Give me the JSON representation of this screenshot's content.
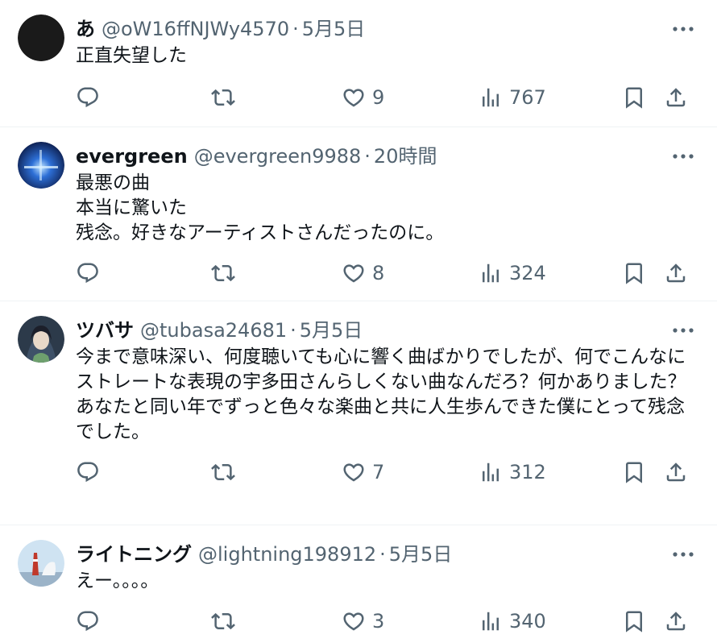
{
  "colors": {
    "text_primary": "#0f1419",
    "text_secondary": "#536471",
    "divider": "#eff3f4"
  },
  "tweets": [
    {
      "display_name": "あ",
      "handle": "@oW16ffNJWy4570",
      "separator": "·",
      "time": "5月5日",
      "text": "正直失望した",
      "likes": "9",
      "views": "767",
      "avatar": "black-circle-avatar"
    },
    {
      "display_name": "evergreen",
      "handle": "@evergreen9988",
      "separator": "·",
      "time": "20時間",
      "text": "最悪の曲\n本当に驚いた\n残念。好きなアーティストさんだったのに。",
      "likes": "8",
      "views": "324",
      "avatar": "blue-light-avatar"
    },
    {
      "display_name": "ツバサ",
      "handle": "@tubasa24681",
      "separator": "·",
      "time": "5月5日",
      "text": "今まで意味深い、何度聴いても心に響く曲ばかりでしたが、何でこんなにストレートな表現の宇多田さんらしくない曲なんだろ？何かありました？\nあなたと同い年でずっと色々な楽曲と共に人生歩んできた僕にとって残念でした。",
      "likes": "7",
      "views": "312",
      "avatar": "anime-girl-avatar"
    },
    {
      "display_name": "ライトニング",
      "handle": "@lightning198912",
      "separator": "·",
      "time": "5月5日",
      "text": "えー。。。。",
      "likes": "3",
      "views": "340",
      "avatar": "tower-avatar"
    }
  ]
}
